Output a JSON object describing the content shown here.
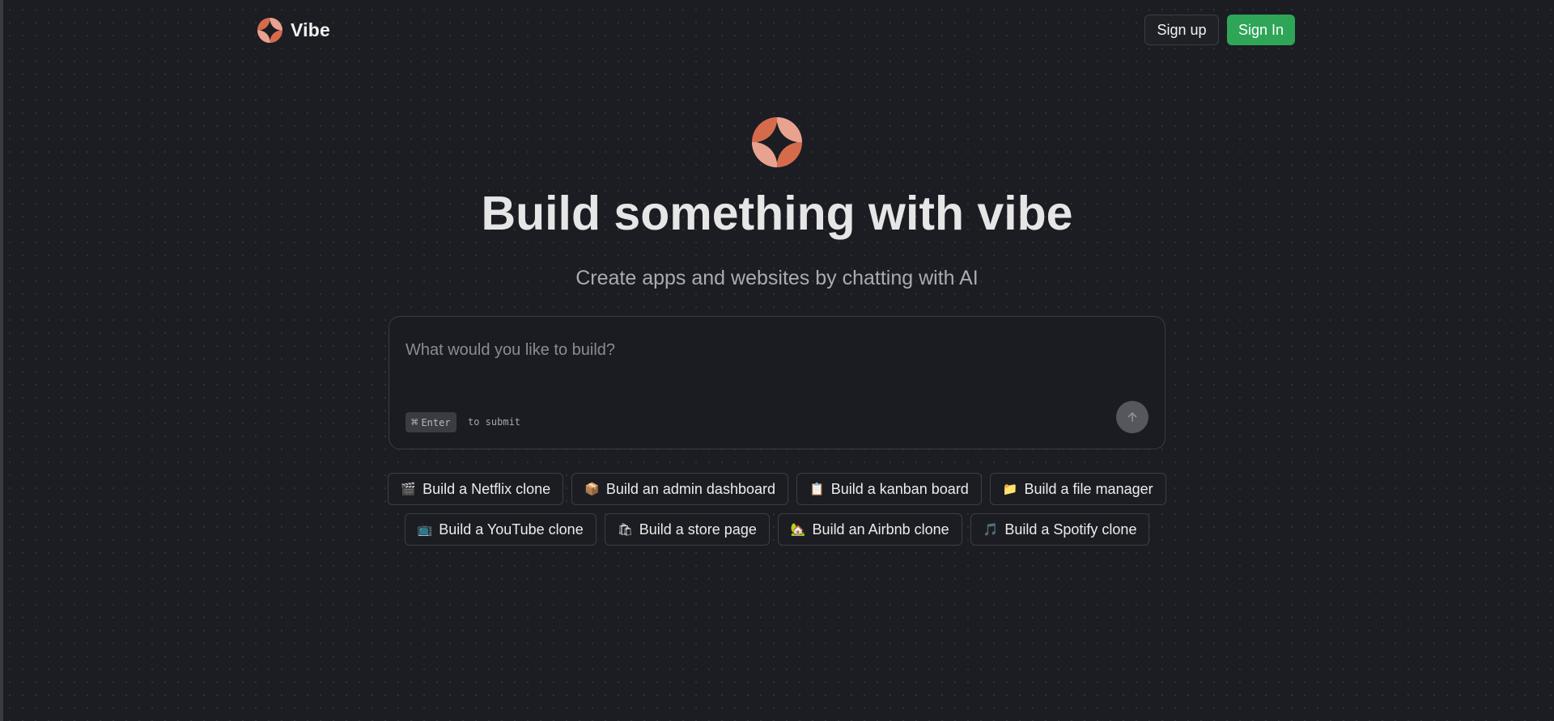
{
  "header": {
    "brand_name": "Vibe",
    "signup_label": "Sign up",
    "signin_label": "Sign In"
  },
  "hero": {
    "title": "Build something with vibe",
    "subtitle": "Create apps and websites by chatting with AI"
  },
  "prompt": {
    "placeholder": "What would you like to build?",
    "value": "",
    "shortcut_symbol": "⌘",
    "shortcut_key": "Enter",
    "shortcut_hint": "to submit"
  },
  "suggestions": {
    "row1": [
      {
        "emoji": "🎬",
        "label": "Build a Netflix clone"
      },
      {
        "emoji": "📦",
        "label": "Build an admin dashboard"
      },
      {
        "emoji": "📋",
        "label": "Build a kanban board"
      },
      {
        "emoji": "📁",
        "label": "Build a file manager"
      }
    ],
    "row2": [
      {
        "emoji": "📺",
        "label": "Build a YouTube clone"
      },
      {
        "emoji": "🛍",
        "label": "Build a store page"
      },
      {
        "emoji": "🏡",
        "label": "Build an Airbnb clone"
      },
      {
        "emoji": "🎵",
        "label": "Build a Spotify clone"
      }
    ]
  },
  "colors": {
    "background": "#1b1d23",
    "accent": "#d66b4c",
    "accent_light": "#e8a290",
    "signin_green": "#2fa558",
    "border": "#3c3e44"
  },
  "icons": {
    "brand_logo": "vibe-logo-icon",
    "submit": "arrow-up-icon",
    "shortcut": "command-key-icon"
  }
}
